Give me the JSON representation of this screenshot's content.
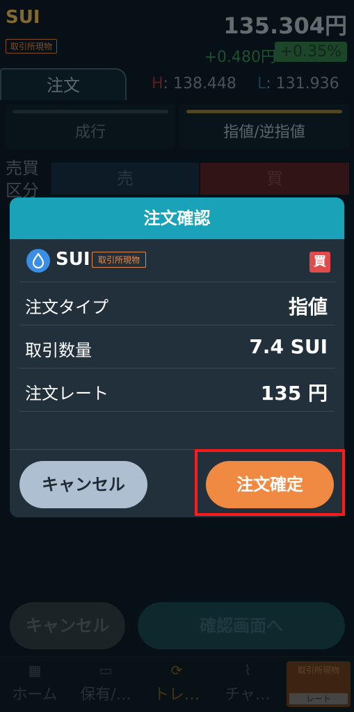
{
  "header": {
    "coin": "SUI",
    "market_tag": "取引所現物",
    "price": "135.304円",
    "change": "+0.480円",
    "change_pct": "+0.35%"
  },
  "order_tab": {
    "label": "注文"
  },
  "high_low": {
    "h_label": "H",
    "h_value": ": 138.448",
    "l_label": "L",
    "l_value": ": 131.936"
  },
  "order_types": [
    {
      "label": "成行"
    },
    {
      "label": "指値/逆指値"
    }
  ],
  "trade_side": {
    "label": "売買\n区分",
    "sell": "売",
    "buy": "買"
  },
  "modal": {
    "title": "注文確認",
    "coin": "SUI",
    "coin_tag": "取引所現物",
    "side_badge": "買",
    "rows": [
      {
        "key": "注文タイプ",
        "value": "指値"
      },
      {
        "key": "取引数量",
        "value": "7.4 SUI"
      },
      {
        "key": "注文レート",
        "value": "135 円"
      }
    ],
    "cancel": "キャンセル",
    "confirm": "注文確定"
  },
  "bottom_actions": {
    "cancel": "キャンセル",
    "confirm": "確認画面へ"
  },
  "nav": [
    {
      "label": "ホーム",
      "icon": "grid-icon"
    },
    {
      "label": "保有/…",
      "icon": "wallet-icon"
    },
    {
      "label": "トレ…",
      "icon": "refresh-icon"
    },
    {
      "label": "チャ…",
      "icon": "chart-icon"
    }
  ],
  "nav_rate": {
    "title": "取引所現物",
    "sub": "レート"
  },
  "colors": {
    "accent": "#1aa3b8",
    "confirm": "#f08a43",
    "highlight": "#ff1b1b",
    "buy": "#e04b4b"
  }
}
